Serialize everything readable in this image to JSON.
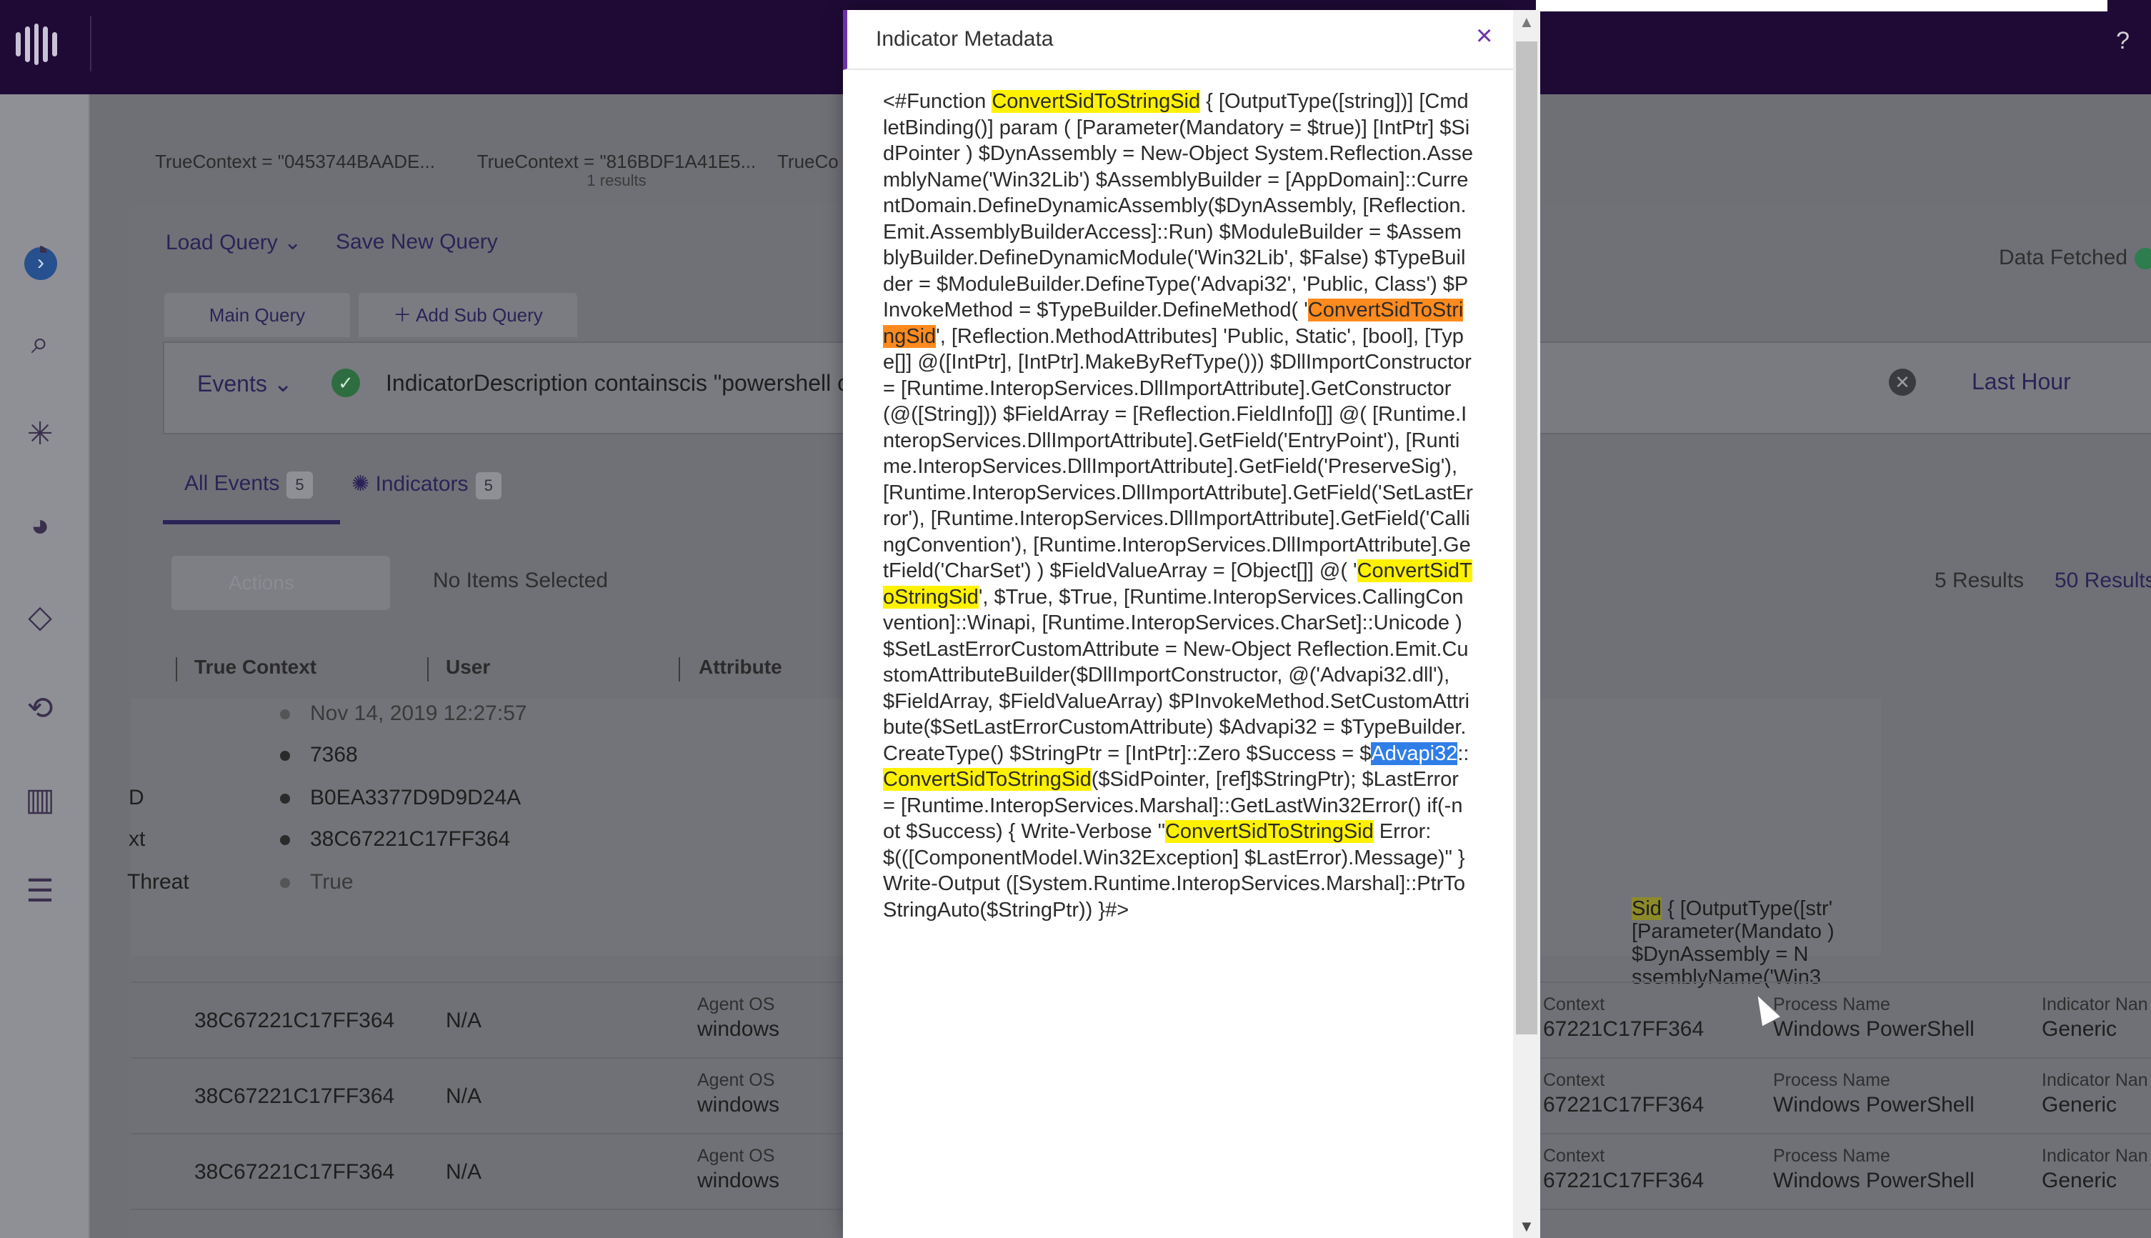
{
  "topbar": {
    "help": "?"
  },
  "context_tabs": [
    {
      "label": "TrueContext = \"0453744BAADE...",
      "sub": ""
    },
    {
      "label": "TrueContext = \"816BDF1A41E5...",
      "sub": "1 results"
    },
    {
      "label": "TrueCo",
      "sub": ""
    }
  ],
  "query": {
    "load_query": "Load Query",
    "save_query": "Save New Query",
    "data_fetched": "Data Fetched",
    "main_query_tab": "Main Query",
    "add_sub_query": "Add Sub Query",
    "events_dropdown": "Events",
    "ok_icon": "✓",
    "query_text": "IndicatorDescription containscis \"powershell co",
    "clear_icon": "✕",
    "time_range": "Last Hour"
  },
  "result_tabs": {
    "all_events": "All Events",
    "all_events_count": "5",
    "indicators": "Indicators",
    "indicators_count": "5"
  },
  "toolbar": {
    "actions": "Actions",
    "no_items": "No Items Selected",
    "results": "5 Results",
    "per_page": "50 Results"
  },
  "table": {
    "headers": [
      "True Context",
      "User",
      "Attribute"
    ]
  },
  "detail": {
    "timestamp": "Nov 14, 2019 12:27:57",
    "pid": "7368",
    "id_key": "D",
    "id_val": "B0EA3377D9D9D24A",
    "ctx_key": "xt",
    "ctx_val": "38C67221C17FF364",
    "threat_key": "Threat",
    "threat_val": "True",
    "right_snippet_hl": "Sid",
    "right_snippet": " { [OutputType([str' [Parameter(Mandato ) $DynAssembly = N ssemblyName('Win3"
  },
  "rows": [
    {
      "context": "38C67221C17FF364",
      "user": "N/A",
      "os_label": "Agent OS",
      "os": "windows",
      "ctx_label": "Context",
      "ctx": "67221C17FF364",
      "proc_label": "Process Name",
      "proc": "Windows PowerShell",
      "ind_label": "Indicator Nan",
      "ind": "Generic"
    },
    {
      "context": "38C67221C17FF364",
      "user": "N/A",
      "os_label": "Agent OS",
      "os": "windows",
      "ctx_label": "Context",
      "ctx": "67221C17FF364",
      "proc_label": "Process Name",
      "proc": "Windows PowerShell",
      "ind_label": "Indicator Nan",
      "ind": "Generic"
    },
    {
      "context": "38C67221C17FF364",
      "user": "N/A",
      "os_label": "Agent OS",
      "os": "windows",
      "ctx_label": "Context",
      "ctx": "67221C17FF364",
      "proc_label": "Process Name",
      "proc": "Windows PowerShell",
      "ind_label": "Indicator Nan",
      "ind": "Generic"
    }
  ],
  "modal": {
    "title": "Indicator Metadata",
    "close": "×",
    "segments": [
      {
        "t": "<#Function ",
        "h": ""
      },
      {
        "t": "ConvertSidToStringSid",
        "h": "y"
      },
      {
        "t": " { [OutputType([string])] [CmdletBinding()] param ( [Parameter(Mandatory = $true)] [IntPtr] $SidPointer ) $DynAssembly = New-Object System.Reflection.AssemblyName('Win32Lib') $AssemblyBuilder = [AppDomain]::CurrentDomain.DefineDynamicAssembly($DynAssembly, [Reflection.Emit.AssemblyBuilderAccess]::Run) $ModuleBuilder = $AssemblyBuilder.DefineDynamicModule('Win32Lib', $False) $TypeBuilder = $ModuleBuilder.DefineType('Advapi32', 'Public, Class') $PInvokeMethod = $TypeBuilder.DefineMethod( '",
        "h": ""
      },
      {
        "t": "ConvertSidToStringSid",
        "h": "o"
      },
      {
        "t": "', [Reflection.MethodAttributes] 'Public, Static', [bool], [Type[]] @([IntPtr], [IntPtr].MakeByRefType())) $DllImportConstructor = [Runtime.InteropServices.DllImportAttribute].GetConstructor(@([String])) $FieldArray = [Reflection.FieldInfo[]] @( [Runtime.InteropServices.DllImportAttribute].GetField('EntryPoint'), [Runtime.InteropServices.DllImportAttribute].GetField('PreserveSig'), [Runtime.InteropServices.DllImportAttribute].GetField('SetLastError'), [Runtime.InteropServices.DllImportAttribute].GetField('CallingConvention'), [Runtime.InteropServices.DllImportAttribute].GetField('CharSet') ) $FieldValueArray = [Object[]] @( '",
        "h": ""
      },
      {
        "t": "ConvertSidToStringSid",
        "h": "y"
      },
      {
        "t": "', $True, $True, [Runtime.InteropServices.CallingConvention]::Winapi, [Runtime.InteropServices.CharSet]::Unicode ) $SetLastErrorCustomAttribute = New-Object Reflection.Emit.CustomAttributeBuilder($DllImportConstructor, @('Advapi32.dll'), $FieldArray, $FieldValueArray) $PInvokeMethod.SetCustomAttribute($SetLastErrorCustomAttribute) $Advapi32 = $TypeBuilder.CreateType() $StringPtr = [IntPtr]::Zero $Success = $",
        "h": ""
      },
      {
        "t": "Advapi32",
        "h": "b"
      },
      {
        "t": "::",
        "h": ""
      },
      {
        "t": "ConvertSidToStringSid",
        "h": "y"
      },
      {
        "t": "($SidPointer, [ref]$StringPtr); $LastError = [Runtime.InteropServices.Marshal]::GetLastWin32Error() if(-not $Success) { Write-Verbose \"",
        "h": ""
      },
      {
        "t": "ConvertSidToStringSid",
        "h": "y"
      },
      {
        "t": " Error: $(([ComponentModel.Win32Exception] $LastError).Message)\" } Write-Output ([System.Runtime.InteropServices.Marshal]::PtrToStringAuto($StringPtr)) }#>",
        "h": ""
      }
    ]
  },
  "colors": {
    "brand": "#6a33a8",
    "topbar": "#1f0a36",
    "highlight": "#fff200",
    "highlight_active": "#ff8a1e",
    "selection": "#2f7ee8"
  }
}
